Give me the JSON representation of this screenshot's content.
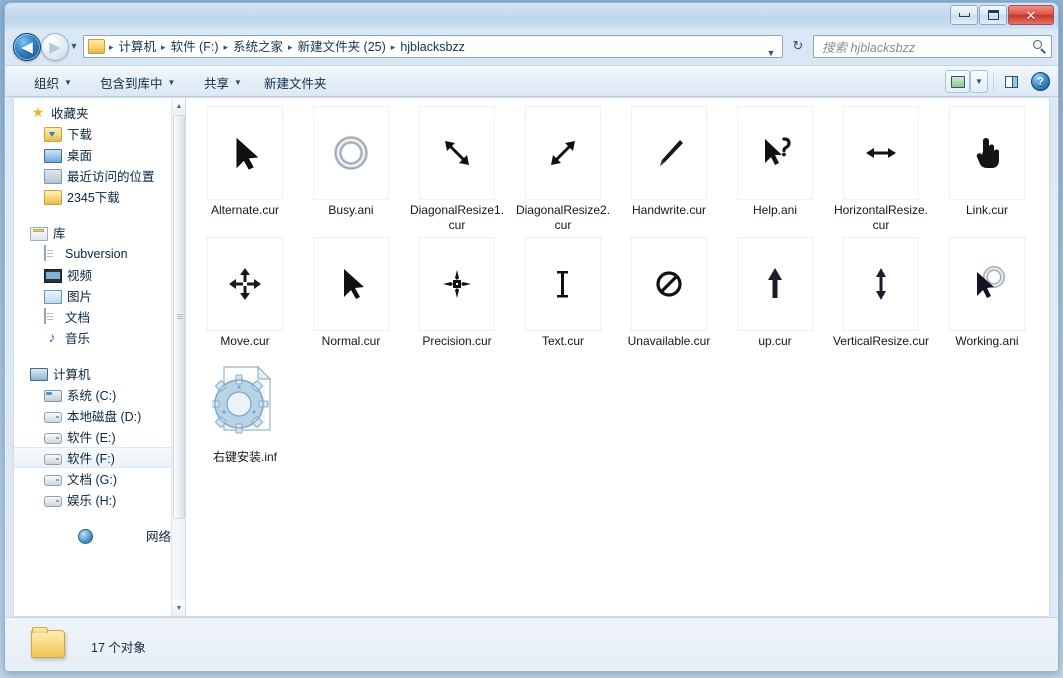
{
  "window": {
    "controls": {
      "minimize_label": "最小化",
      "maximize_label": "最大化",
      "close_label": "✕"
    }
  },
  "address_bar": {
    "back_label": "◀",
    "forward_label": "▶",
    "recent_dropdown_label": "▼",
    "breadcrumbs": [
      "计算机",
      "软件 (F:)",
      "系统之家",
      "新建文件夹 (25)",
      "hjblacksbzz"
    ],
    "separator": "▸",
    "dropdown_caret": "▼",
    "refresh_label": "↻",
    "search_placeholder": "搜索 hjblacksbzz"
  },
  "command_bar": {
    "buttons": [
      {
        "label": "组织",
        "caret": "▼"
      },
      {
        "label": "包含到库中",
        "caret": "▼"
      },
      {
        "label": "共享",
        "caret": "▼"
      },
      {
        "label": "新建文件夹",
        "caret": ""
      }
    ],
    "view_caret": "▼",
    "help_label": "?"
  },
  "sidebar": {
    "groups": [
      {
        "header": {
          "label": "收藏夹",
          "icon": "star-icon"
        },
        "items": [
          {
            "label": "下载",
            "icon": "download-folder-icon"
          },
          {
            "label": "桌面",
            "icon": "desktop-icon"
          },
          {
            "label": "最近访问的位置",
            "icon": "recent-places-icon"
          },
          {
            "label": "2345下载",
            "icon": "folder-icon"
          }
        ]
      },
      {
        "header": {
          "label": "库",
          "icon": "library-icon"
        },
        "items": [
          {
            "label": "Subversion",
            "icon": "document-icon"
          },
          {
            "label": "视频",
            "icon": "video-icon"
          },
          {
            "label": "图片",
            "icon": "picture-icon"
          },
          {
            "label": "文档",
            "icon": "document-icon"
          },
          {
            "label": "音乐",
            "icon": "music-note-icon"
          }
        ]
      },
      {
        "header": {
          "label": "计算机",
          "icon": "computer-icon"
        },
        "items": [
          {
            "label": "系统 (C:)",
            "icon": "system-drive-icon",
            "selected": false
          },
          {
            "label": "本地磁盘 (D:)",
            "icon": "drive-icon",
            "selected": false
          },
          {
            "label": "软件 (E:)",
            "icon": "drive-icon",
            "selected": false
          },
          {
            "label": "软件 (F:)",
            "icon": "drive-icon",
            "selected": true
          },
          {
            "label": "文档 (G:)",
            "icon": "drive-icon",
            "selected": false
          },
          {
            "label": "娱乐 (H:)",
            "icon": "drive-icon",
            "selected": false
          }
        ]
      },
      {
        "header": {
          "label": "网络",
          "icon": "network-icon"
        },
        "items": []
      }
    ],
    "scrollbar": {
      "up_arrow": "▲",
      "down_arrow": "▼"
    }
  },
  "files": [
    {
      "name": "Alternate.cur",
      "icon": "cursor-alternate-icon"
    },
    {
      "name": "Busy.ani",
      "icon": "cursor-busy-icon"
    },
    {
      "name": "DiagonalResize1.cur",
      "icon": "cursor-diagonal-resize-1-icon"
    },
    {
      "name": "DiagonalResize2.cur",
      "icon": "cursor-diagonal-resize-2-icon"
    },
    {
      "name": "Handwrite.cur",
      "icon": "cursor-handwrite-icon"
    },
    {
      "name": "Help.ani",
      "icon": "cursor-help-icon"
    },
    {
      "name": "HorizontalResize.cur",
      "icon": "cursor-horizontal-resize-icon"
    },
    {
      "name": "Link.cur",
      "icon": "cursor-link-icon"
    },
    {
      "name": "Move.cur",
      "icon": "cursor-move-icon"
    },
    {
      "name": "Normal.cur",
      "icon": "cursor-normal-icon"
    },
    {
      "name": "Precision.cur",
      "icon": "cursor-precision-icon"
    },
    {
      "name": "Text.cur",
      "icon": "cursor-text-icon"
    },
    {
      "name": "Unavailable.cur",
      "icon": "cursor-unavailable-icon"
    },
    {
      "name": "up.cur",
      "icon": "cursor-up-icon"
    },
    {
      "name": "VerticalResize.cur",
      "icon": "cursor-vertical-resize-icon"
    },
    {
      "name": "Working.ani",
      "icon": "cursor-working-icon"
    },
    {
      "name": "右键安装.inf",
      "icon": "inf-setup-file-icon"
    }
  ],
  "status_bar": {
    "text": "17 个对象",
    "folder_icon": "folder-icon"
  },
  "colors": {
    "accent": "#2f7fc4",
    "close_button": "#c9352a",
    "folder_yellow": "#f6d579",
    "selection": "#e9f2fa"
  }
}
